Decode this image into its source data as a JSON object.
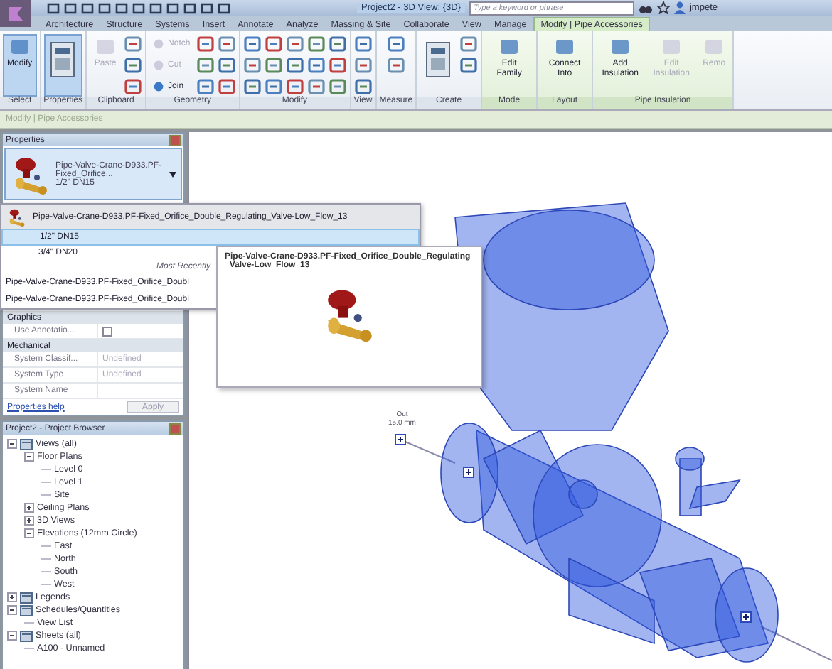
{
  "title_bar": {
    "title": "Project2 - 3D View: {3D}",
    "search": {
      "placeholder": "Type a keyword or phrase"
    },
    "user": "jmpete"
  },
  "tabs": [
    {
      "label": "Architecture",
      "selected": false
    },
    {
      "label": "Structure",
      "selected": false
    },
    {
      "label": "Systems",
      "selected": false
    },
    {
      "label": "Insert",
      "selected": false
    },
    {
      "label": "Annotate",
      "selected": false
    },
    {
      "label": "Analyze",
      "selected": false
    },
    {
      "label": "Massing & Site",
      "selected": false
    },
    {
      "label": "Collaborate",
      "selected": false
    },
    {
      "label": "View",
      "selected": false
    },
    {
      "label": "Manage",
      "selected": false
    },
    {
      "label": "Modify | Pipe Accessories",
      "selected": true
    }
  ],
  "ribbon": {
    "panels": [
      {
        "label": "Select",
        "contextual": false,
        "tools": [
          {
            "kind": "large",
            "label": "Modify",
            "active": true,
            "disabled": false
          }
        ]
      },
      {
        "label": "Properties",
        "contextual": false,
        "tools": [
          {
            "kind": "large-icon",
            "active": true
          }
        ]
      },
      {
        "label": "Clipboard",
        "contextual": false,
        "tools": [
          {
            "kind": "large",
            "label": "Paste",
            "active": false,
            "disabled": true
          },
          {
            "kind": "icon"
          },
          {
            "kind": "icon"
          },
          {
            "kind": "icon"
          }
        ]
      },
      {
        "label": "Geometry",
        "contextual": false,
        "tools": [
          {
            "kind": "small",
            "label": "Notch",
            "disabled": true
          },
          {
            "kind": "small",
            "label": "Cut",
            "disabled": true
          },
          {
            "kind": "small",
            "label": "Join",
            "disabled": false
          },
          {
            "kind": "icon"
          },
          {
            "kind": "icon"
          },
          {
            "kind": "icon"
          },
          {
            "kind": "icon"
          },
          {
            "kind": "icon"
          },
          {
            "kind": "icon"
          }
        ]
      },
      {
        "label": "Modify",
        "contextual": false,
        "tools": [
          {
            "kind": "icon"
          },
          {
            "kind": "icon"
          },
          {
            "kind": "icon"
          },
          {
            "kind": "icon"
          },
          {
            "kind": "icon"
          },
          {
            "kind": "icon"
          },
          {
            "kind": "icon"
          },
          {
            "kind": "icon"
          },
          {
            "kind": "icon"
          },
          {
            "kind": "icon"
          },
          {
            "kind": "icon"
          },
          {
            "kind": "icon"
          },
          {
            "kind": "icon"
          },
          {
            "kind": "icon"
          },
          {
            "kind": "icon"
          }
        ]
      },
      {
        "label": "View",
        "contextual": false,
        "tools": [
          {
            "kind": "icon"
          },
          {
            "kind": "icon"
          },
          {
            "kind": "icon"
          }
        ]
      },
      {
        "label": "Measure",
        "contextual": false,
        "tools": [
          {
            "kind": "icon"
          },
          {
            "kind": "icon"
          }
        ]
      },
      {
        "label": "Create",
        "contextual": false,
        "tools": [
          {
            "kind": "large-icon",
            "active": false
          },
          {
            "kind": "icon"
          },
          {
            "kind": "icon"
          }
        ]
      },
      {
        "label": "Mode",
        "contextual": true,
        "tools": [
          {
            "kind": "large",
            "label": "Edit Family",
            "active": false,
            "disabled": false
          }
        ]
      },
      {
        "label": "Layout",
        "contextual": true,
        "tools": [
          {
            "kind": "large",
            "label": "Connect Into",
            "active": false,
            "disabled": false
          }
        ]
      },
      {
        "label": "Pipe Insulation",
        "contextual": true,
        "tools": [
          {
            "kind": "large",
            "label": "Add Insulation",
            "active": false,
            "disabled": false
          },
          {
            "kind": "large",
            "label": "Edit Insulation",
            "active": false,
            "disabled": true
          },
          {
            "kind": "large",
            "label": "Remo",
            "active": false,
            "disabled": true
          }
        ]
      }
    ]
  },
  "context_bar": "Modify | Pipe Accessories",
  "properties": {
    "title": "Properties",
    "type_selector": {
      "family": "Pipe-Valve-Crane-D933.PF-Fixed_Orifice...",
      "type": "1/2\" DN15"
    },
    "groups": [
      {
        "name": "Graphics",
        "rows": [
          {
            "kind": "checkbox",
            "label": "Use Annotatio...",
            "checked": false
          }
        ]
      },
      {
        "name": "Mechanical",
        "rows": [
          {
            "kind": "text",
            "label": "System Classif...",
            "value": "Undefined"
          },
          {
            "kind": "text",
            "label": "System Type",
            "value": "Undefined"
          },
          {
            "kind": "text",
            "label": "System Name"
          }
        ]
      }
    ],
    "help_link": "Properties help",
    "apply": "Apply"
  },
  "type_dropdown": {
    "family": "Pipe-Valve-Crane-D933.PF-Fixed_Orifice_Double_Regulating_Valve-Low_Flow_13",
    "types": [
      {
        "label": "1/2\" DN15",
        "selected": true
      },
      {
        "label": "3/4\" DN20",
        "selected": false
      }
    ],
    "recent_heading": "Most Recently",
    "recent": [
      "Pipe-Valve-Crane-D933.PF-Fixed_Orifice_Doubl",
      "Pipe-Valve-Crane-D933.PF-Fixed_Orifice_Doubl"
    ]
  },
  "tooltip": {
    "title": "Pipe-Valve-Crane-D933.PF-Fixed_Orifice_Double_Regulating_Valve-Low_Flow_13"
  },
  "browser": {
    "title": "Project2 - Project Browser",
    "tree": [
      {
        "label": "Views (all)",
        "expanded": true,
        "children": [
          {
            "label": "Floor Plans",
            "expanded": true,
            "children": [
              {
                "label": "Level 0"
              },
              {
                "label": "Level 1"
              },
              {
                "label": "Site"
              }
            ]
          },
          {
            "label": "Ceiling Plans",
            "expanded": false
          },
          {
            "label": "3D Views",
            "expanded": false
          },
          {
            "label": "Elevations (12mm Circle)",
            "expanded": true,
            "children": [
              {
                "label": "East"
              },
              {
                "label": "North"
              },
              {
                "label": "South"
              },
              {
                "label": "West"
              }
            ]
          }
        ]
      },
      {
        "label": "Legends",
        "expanded": false
      },
      {
        "label": "Schedules/Quantities",
        "expanded": true,
        "children": [
          {
            "label": "View List"
          }
        ]
      },
      {
        "label": "Sheets (all)",
        "expanded": true,
        "children": [
          {
            "label": "A100 - Unnamed"
          }
        ]
      }
    ]
  },
  "viewport": {
    "connector": {
      "label": "Out",
      "size": "15.0 mm"
    }
  }
}
